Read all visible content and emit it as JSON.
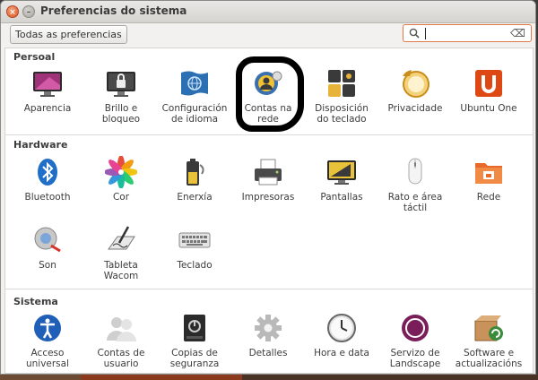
{
  "window": {
    "title": "Preferencias do sistema"
  },
  "toolbar": {
    "all_settings": "Todas as preferencias",
    "search_value": ""
  },
  "sections": [
    {
      "title": "Persoal",
      "items": [
        {
          "label": "Aparencia"
        },
        {
          "label": "Brillo e\nbloqueo"
        },
        {
          "label": "Configuración\nde idioma"
        },
        {
          "label": "Contas na\nrede"
        },
        {
          "label": "Disposición\ndo teclado"
        },
        {
          "label": "Privacidade"
        },
        {
          "label": "Ubuntu One"
        }
      ]
    },
    {
      "title": "Hardware",
      "items": [
        {
          "label": "Bluetooth"
        },
        {
          "label": "Cor"
        },
        {
          "label": "Enerxía"
        },
        {
          "label": "Impresoras"
        },
        {
          "label": "Pantallas"
        },
        {
          "label": "Rato e área\ntáctil"
        },
        {
          "label": "Rede"
        },
        {
          "label": "Son"
        },
        {
          "label": "Tableta\nWacom"
        },
        {
          "label": "Teclado"
        }
      ]
    },
    {
      "title": "Sistema",
      "items": [
        {
          "label": "Acceso\nuniversal"
        },
        {
          "label": "Contas de\nusuario"
        },
        {
          "label": "Copias de\nseguranza"
        },
        {
          "label": "Detalles"
        },
        {
          "label": "Hora e data"
        },
        {
          "label": "Servizo de\nLandscape"
        },
        {
          "label": "Software e\nactualizacións"
        }
      ]
    }
  ]
}
